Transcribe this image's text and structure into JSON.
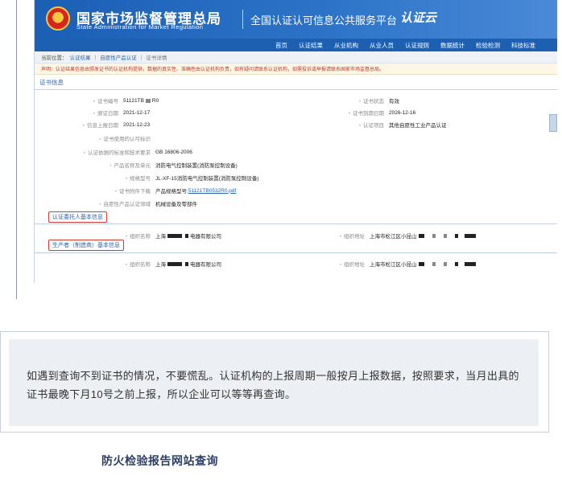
{
  "site": {
    "emblem_glyph": "★",
    "org_name_cn": "国家市场监督管理总局",
    "org_name_en": "State Administration for Market Regulation",
    "platform_name": "全国认证认可信息公共服务平台",
    "logo_text": "认证云"
  },
  "nav": {
    "items": [
      "首页",
      "认证结果",
      "从业机构",
      "从业人员",
      "认证规则",
      "数据统计",
      "检验检测",
      "科技标准"
    ]
  },
  "breadcrumb": {
    "prefix": "当前位置：",
    "items": [
      "认证结果",
      "自愿性产品认证",
      "证书详情"
    ]
  },
  "disclaimer": "声明：认证结果信息由颁发证书的认证机构提供，数据的真实性、准确性由认证机构负责，如有疑问请联系认证机构，如需投诉或举报请联系国家市场监督总局。",
  "cert_section": {
    "title": "证书信息",
    "fields": {
      "cert_no_label": "证书编号",
      "cert_no_value": "51121TB",
      "cert_no_suffix": "R0",
      "status_label": "证书状态",
      "status_value": "有效",
      "issue_label": "颁证日期",
      "issue_value": "2021-12-17",
      "expire_label": "证书到期日期",
      "expire_value": "2026-12-16",
      "report_label": "信息上报日期",
      "report_value": "2021-12-23",
      "project_label": "认证项目",
      "project_value": "其他自愿性工业产品认证",
      "mark_label": "证书使用的认可标识",
      "basis_label": "认证依据的标准和技术要求",
      "basis_value": "GB 16806-2006",
      "product_name_label": "产品名称及单元",
      "product_name_value": "消防电气控制装置(消防泵控制设备)",
      "model_label": "规格型号",
      "model_value": "JL-XF-15消防电气控制装置(消防泵控制设备)",
      "attachment_label": "证书附件下载",
      "attachment_prefix": "产品规格型号:",
      "attachment_link": "51121TB0532R0.pdf",
      "domain_label": "自愿性产品认证领域",
      "domain_value": "机械设备及零部件"
    }
  },
  "client_section": {
    "title": "认证委托人基本信息",
    "org_label": "组织名称",
    "org_value_start": "上海",
    "org_value_end": "电器有限公司",
    "addr_label": "组织地址",
    "addr_value": "上海市松江区小昆山"
  },
  "maker_section": {
    "title": "生产者（制造商）基本信息",
    "org_label": "组织名称",
    "org_value_start": "上海",
    "org_value_end": "电器有限公司",
    "addr_label": "组织地址",
    "addr_value": "上海市松江区小昆山"
  },
  "note": {
    "text": "如遇到查询不到证书的情况，不要慌乱。认证机构的上报周期一般按月上报数据，按照要求，当月出具的证书最晚下月10号之前上报，所以企业可以等等再查询。"
  },
  "footer": {
    "heading": "防火检验报告网站查询"
  }
}
